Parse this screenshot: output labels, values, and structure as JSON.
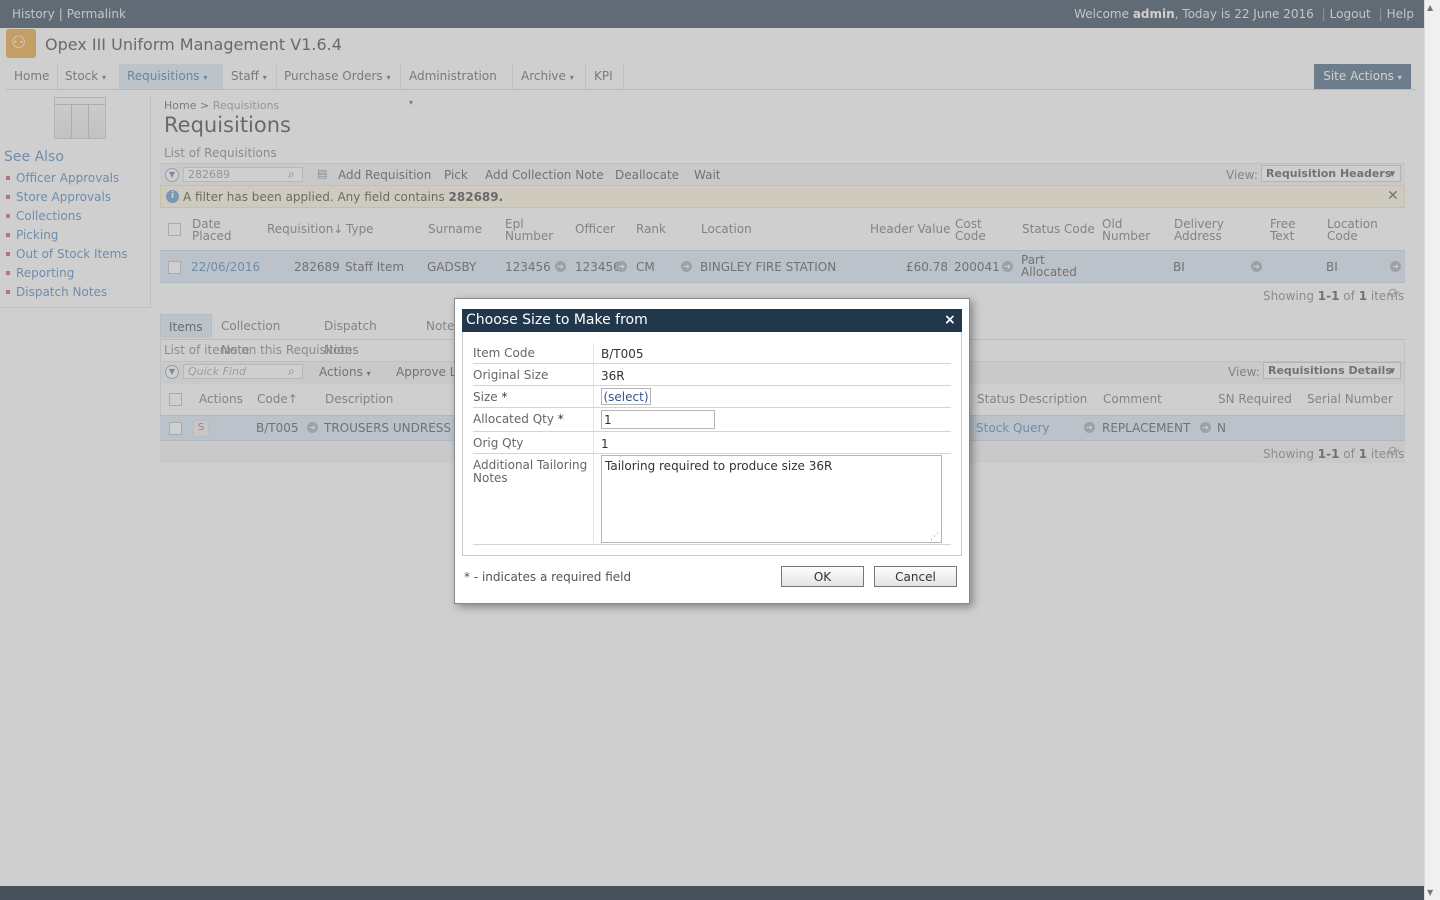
{
  "topbar": {
    "history": "History",
    "permalink": "Permalink",
    "welcome_prefix": "Welcome",
    "user": "admin",
    "today_text": ", Today is 22 June 2016",
    "logout": "Logout",
    "help": "Help"
  },
  "app": {
    "title": "Opex III Uniform Management V1.6.4"
  },
  "nav": {
    "items": [
      "Home",
      "Stock",
      "Requisitions",
      "Staff",
      "Purchase Orders",
      "Administration",
      "Archive",
      "KPI"
    ],
    "active": "Requisitions",
    "site_actions": "Site Actions"
  },
  "left": {
    "see_also": "See Also",
    "links": [
      "Officer Approvals",
      "Store Approvals",
      "Collections",
      "Picking",
      "Out of Stock Items",
      "Reporting",
      "Dispatch Notes"
    ]
  },
  "breadcrumb": {
    "home": "Home",
    "sep": ">",
    "current": "Requisitions"
  },
  "page": {
    "title": "Requisitions",
    "list_caption": "List of Requisitions"
  },
  "toolbar1": {
    "search_value": "282689",
    "buttons": [
      "Add Requisition",
      "Pick",
      "Add Collection Note",
      "Deallocate",
      "Wait"
    ],
    "view_label": "View:",
    "view_value": "Requisition Headers"
  },
  "filter": {
    "text": "A filter has been applied. Any field contains",
    "term": "282689."
  },
  "grid1": {
    "headers": {
      "date_placed": "Date Placed",
      "requisition": "Requisition↓",
      "type": "Type",
      "surname": "Surname",
      "epl_number": "Epl Number",
      "officer": "Officer",
      "rank": "Rank",
      "location": "Location",
      "header_value": "Header Value",
      "cost_code": "Cost Code",
      "status_code": "Status Code",
      "old_number": "Old Number",
      "delivery_address": "Delivery Address",
      "free_text": "Free Text",
      "location_code": "Location Code"
    },
    "row": {
      "date_placed": "22/06/2016",
      "requisition": "282689",
      "type": "Staff Item",
      "surname": "GADSBY",
      "epl_number": "123456",
      "officer": "123456",
      "rank": "CM",
      "location": "BINGLEY FIRE STATION",
      "header_value": "£60.78",
      "cost_code": "200041",
      "status_code": "Part Allocated",
      "delivery_address": "BI",
      "location_code": "BI"
    },
    "paging": {
      "prefix": "Showing",
      "range": "1-1",
      "of": "of",
      "count": "1",
      "suffix": "items"
    }
  },
  "tabs": {
    "items": [
      "Items",
      "Collection Note",
      "Dispatch Notes",
      "Notes"
    ],
    "active": "Items"
  },
  "items_section": {
    "caption": "List of items on this Requisition",
    "quick_find_placeholder": "Quick Find",
    "actions": "Actions",
    "approve": "Approve L",
    "view_label": "View:",
    "view_value": "Requisitions Details",
    "headers": {
      "actions": "Actions",
      "code": "Code↑",
      "description": "Description",
      "status_description": "Status Description",
      "comment": "Comment",
      "sn_required": "SN Required",
      "serial_number": "Serial Number"
    },
    "row": {
      "action_badge": "S",
      "code": "B/T005",
      "description": "TROUSERS UNDRESS C",
      "status_description": "Stock Query",
      "comment": "REPLACEMENT",
      "sn_required": "N"
    },
    "paging": {
      "prefix": "Showing",
      "range": "1-1",
      "of": "of",
      "count": "1",
      "suffix": "items"
    }
  },
  "dialog": {
    "title": "Choose Size to Make from",
    "close": "×",
    "fields": {
      "item_code_label": "Item Code",
      "item_code": "B/T005",
      "original_size_label": "Original Size",
      "original_size": "36R",
      "size_label": "Size",
      "size_value": "(select)",
      "allocated_qty_label": "Allocated Qty",
      "allocated_qty": "1",
      "orig_qty_label": "Orig Qty",
      "orig_qty": "1",
      "notes_label": "Additional Tailoring Notes",
      "notes": "Tailoring required to produce size 36R",
      "required_mark": "*"
    },
    "required_note": "* - indicates a required field",
    "ok": "OK",
    "cancel": "Cancel"
  },
  "colors": {
    "topbar": "#21374c",
    "accent": "#3d7ab8",
    "row_selected": "#d7e5f2",
    "logo": "#e99c2f"
  }
}
